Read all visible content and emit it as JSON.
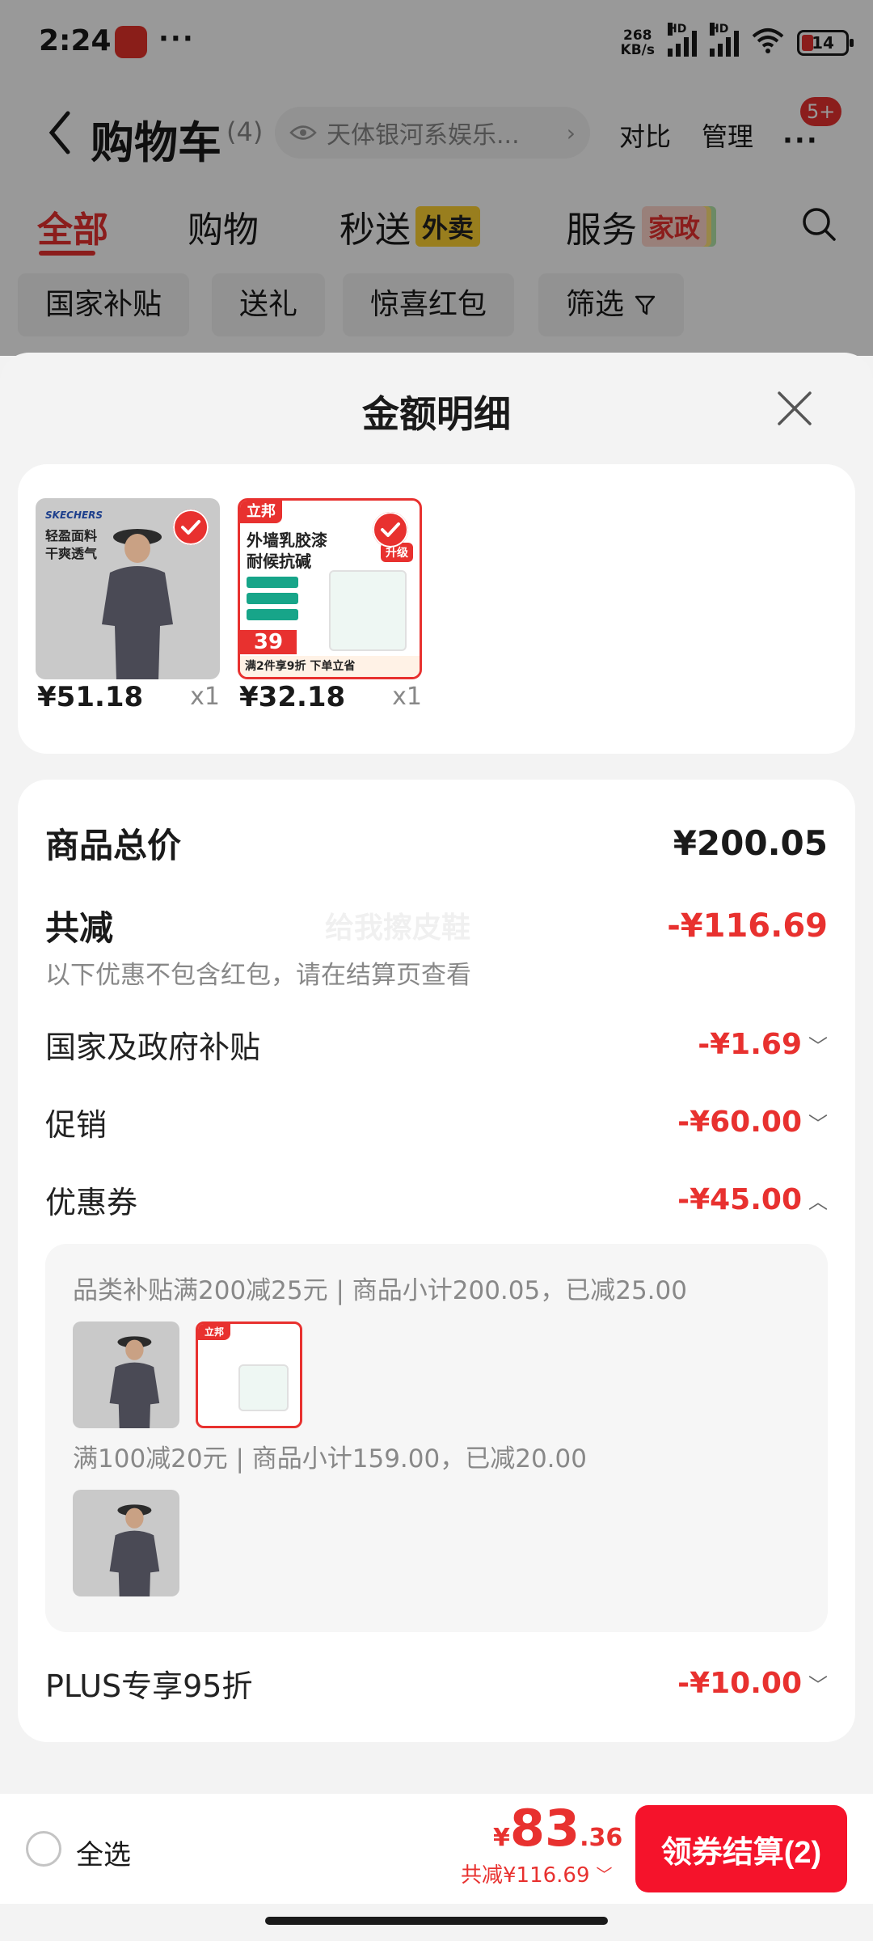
{
  "status_bar": {
    "time": "2:24",
    "dots": "···",
    "net_speed_value": "268",
    "net_speed_unit": "KB/s",
    "hd_label": "HD",
    "battery": "14"
  },
  "nav": {
    "title": "购物车",
    "count": "(4)",
    "address": "天体银河系娱乐...",
    "compare": "对比",
    "manage": "管理",
    "badge": "5+"
  },
  "tabs": [
    {
      "label": "全部"
    },
    {
      "label": "购物"
    },
    {
      "label": "秒送",
      "tag": "外卖"
    },
    {
      "label": "服务",
      "tag": "家政"
    }
  ],
  "chips": [
    "国家补贴",
    "送礼",
    "惊喜红包",
    "筛选"
  ],
  "sheet": {
    "title": "金额明细",
    "products": [
      {
        "price": "¥51.18",
        "qty": "x1",
        "brand": "SKECHERS",
        "text_line1": "轻盈面料",
        "text_line2": "干爽透气"
      },
      {
        "price": "¥32.18",
        "qty": "x1",
        "brand": "立邦",
        "text_line1": "外墙乳胶漆",
        "text_line2": "耐候抗碱",
        "img_price": "39",
        "img_foot": "满2件享9折  下单立省",
        "img_badge": "升级"
      }
    ],
    "watermark": "给我擦皮鞋",
    "total_label": "商品总价",
    "total_value": "¥200.05",
    "discount_label": "共减",
    "discount_value": "-¥116.69",
    "discount_note": "以下优惠不包含红包，请在结算页查看",
    "items": [
      {
        "label": "国家及政府补贴",
        "value": "-¥1.69"
      },
      {
        "label": "促销",
        "value": "-¥60.00"
      },
      {
        "label": "优惠券",
        "value": "-¥45.00"
      }
    ],
    "coupon_details": [
      {
        "text": "品类补贴满200减25元 | 商品小计200.05，已减25.00"
      },
      {
        "text": "满100减20元 | 商品小计159.00，已减20.00"
      }
    ],
    "plus_label": "PLUS专享95折",
    "plus_value": "-¥10.00"
  },
  "bottom_bar": {
    "select_all": "全选",
    "currency": "¥",
    "total_int": "83",
    "total_dec": ".36",
    "saved": "共减¥116.69",
    "checkout": "领券结算(2)"
  },
  "colors": {
    "accent_red": "#e8312f",
    "checkout_red": "#f5132b",
    "sheet_bg": "#f3f3f3"
  },
  "icons": [
    "back-icon",
    "eye-icon",
    "chevron-right-icon",
    "more-icon",
    "search-icon",
    "filter-icon",
    "close-icon",
    "check-icon",
    "chevron-down-icon",
    "chevron-up-icon"
  ]
}
